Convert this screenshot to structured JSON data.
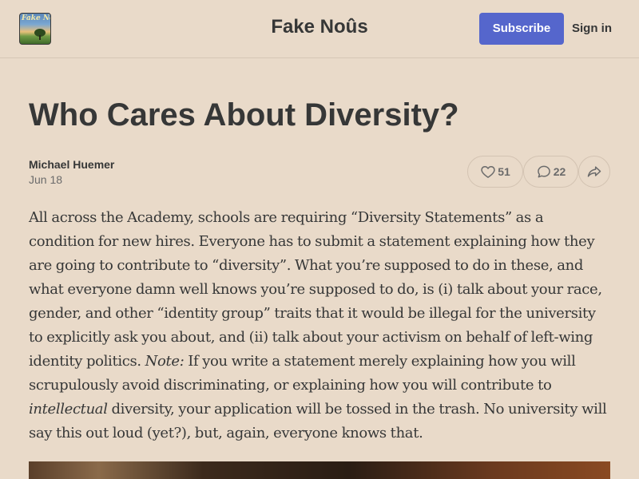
{
  "header": {
    "logo_text": "Fake Noûs",
    "site_title": "Fake Noûs",
    "subscribe_label": "Subscribe",
    "signin_label": "Sign in"
  },
  "post": {
    "title": "Who Cares About Diversity?",
    "author": "Michael Huemer",
    "date": "Jun 18",
    "likes": "51",
    "comments": "22",
    "body": {
      "p1_a": "All across the Academy, schools are requiring “Diversity Statements” as a condition for new hires. Everyone has to submit a statement explaining how they are going to contribute to “diversity”. What you’re supposed to do in these, and what everyone damn well knows you’re supposed to do, is (i) talk about your race, gender, and other “identity group” traits that it would be illegal for the university to explicitly ask you about, and (ii) talk about your activism on behalf of left-wing identity politics. ",
      "p1_note": "Note:",
      "p1_b": " If you write a statement merely explaining how you will scrupulously avoid discriminating, or explaining how you will contribute to ",
      "p1_intellectual": "intellectual",
      "p1_c": " diversity, your application will be tossed in the trash. No university will say this out loud (yet?), but, again, everyone knows that."
    }
  },
  "icons": {
    "like": "heart-icon",
    "comment": "comment-bubble-icon",
    "share": "share-arrow-icon"
  },
  "colors": {
    "background": "#e9dac9",
    "accent": "#5566cc",
    "text": "#363737"
  }
}
